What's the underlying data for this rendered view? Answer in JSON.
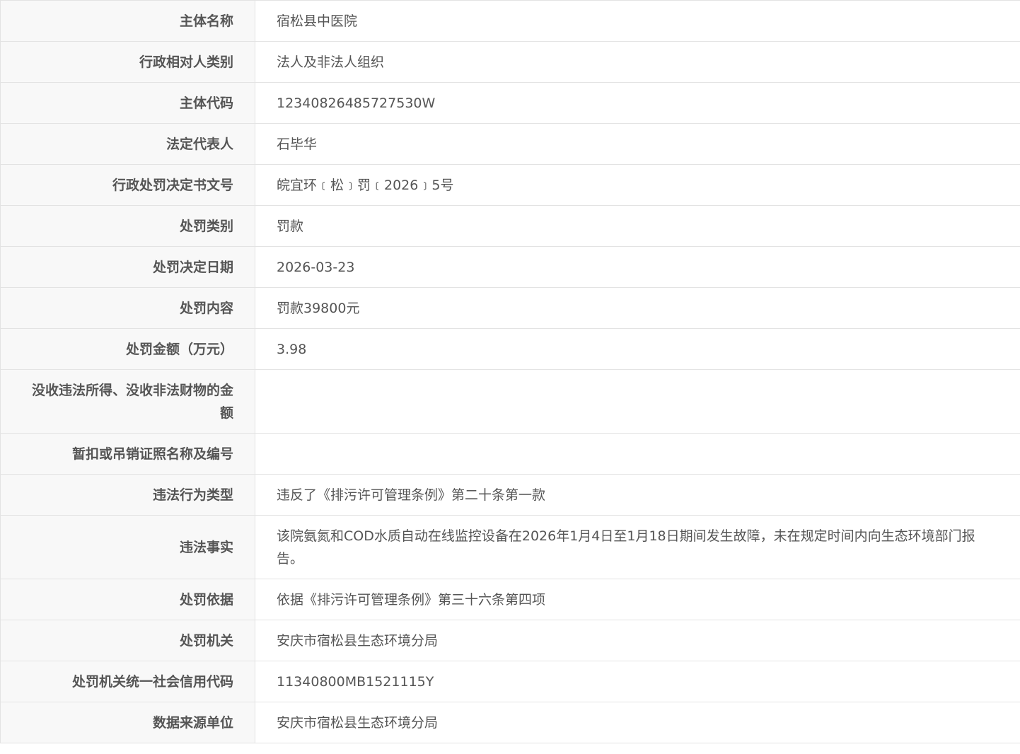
{
  "rows": [
    {
      "label": "主体名称",
      "value": "宿松县中医院"
    },
    {
      "label": "行政相对人类别",
      "value": "法人及非法人组织"
    },
    {
      "label": "主体代码",
      "value": "12340826485727530W"
    },
    {
      "label": "法定代表人",
      "value": "石毕华"
    },
    {
      "label": "行政处罚决定书文号",
      "value": "皖宜环﹝松﹞罚﹝2026﹞5号"
    },
    {
      "label": "处罚类别",
      "value": "罚款"
    },
    {
      "label": "处罚决定日期",
      "value": "2026-03-23"
    },
    {
      "label": "处罚内容",
      "value": "罚款39800元"
    },
    {
      "label": "处罚金额（万元）",
      "value": "3.98"
    },
    {
      "label": "没收违法所得、没收非法财物的金额",
      "value": ""
    },
    {
      "label": "暂扣或吊销证照名称及编号",
      "value": ""
    },
    {
      "label": "违法行为类型",
      "value": "违反了《排污许可管理条例》第二十条第一款"
    },
    {
      "label": "违法事实",
      "value": "该院氨氮和COD水质自动在线监控设备在2026年1月4日至1月18日期间发生故障，未在规定时间内向生态环境部门报告。"
    },
    {
      "label": "处罚依据",
      "value": "依据《排污许可管理条例》第三十六条第四项"
    },
    {
      "label": "处罚机关",
      "value": "安庆市宿松县生态环境分局"
    },
    {
      "label": "处罚机关统一社会信用代码",
      "value": "11340800MB1521115Y"
    },
    {
      "label": "数据来源单位",
      "value": "安庆市宿松县生态环境分局"
    }
  ]
}
